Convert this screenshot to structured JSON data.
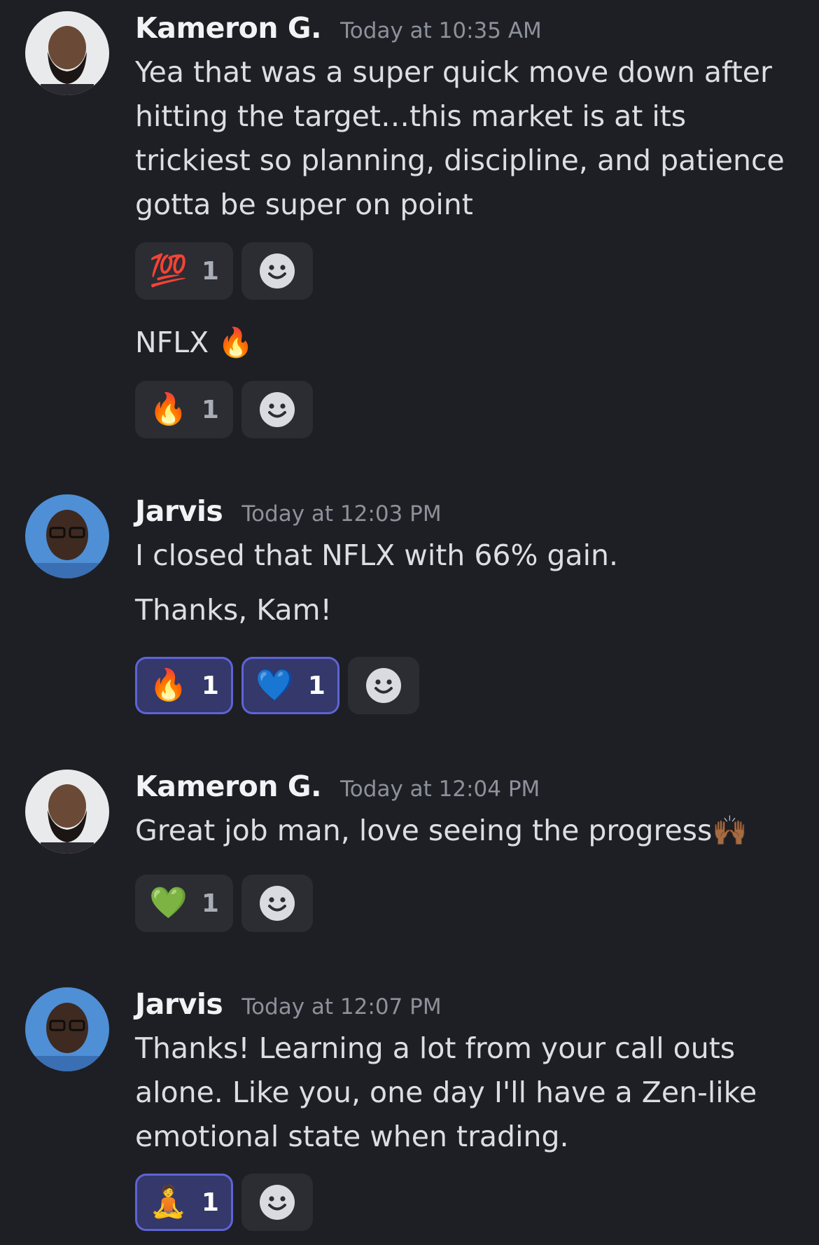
{
  "messages": [
    {
      "author": "Kameron G.",
      "timestamp": "Today at 10:35 AM",
      "avatar": "avatar-kameron",
      "lines": [
        {
          "text": "Yea that was a super quick move down after hitting the target…this market is at its trickiest so planning, discipline, and patience gotta be super on point",
          "reactions": [
            {
              "emoji": "💯",
              "count": "1",
              "active": false
            }
          ]
        },
        {
          "text": "NFLX 🔥",
          "reactions": [
            {
              "emoji": "🔥",
              "count": "1",
              "active": false
            }
          ]
        }
      ]
    },
    {
      "author": "Jarvis",
      "timestamp": "Today at 12:03 PM",
      "avatar": "avatar-jarvis",
      "lines": [
        {
          "text": "I closed that NFLX with 66% gain."
        },
        {
          "text": "Thanks, Kam!",
          "reactions": [
            {
              "emoji": "🔥",
              "count": "1",
              "active": true
            },
            {
              "emoji": "💙",
              "count": "1",
              "active": true
            }
          ]
        }
      ]
    },
    {
      "author": "Kameron G.",
      "timestamp": "Today at 12:04 PM",
      "avatar": "avatar-kameron",
      "lines": [
        {
          "text": "Great job man, love seeing the progress🙌🏾",
          "reactions": [
            {
              "emoji": "💚",
              "count": "1",
              "active": false
            }
          ]
        }
      ]
    },
    {
      "author": "Jarvis",
      "timestamp": "Today at 12:07 PM",
      "avatar": "avatar-jarvis",
      "lines": [
        {
          "text": "Thanks! Learning a lot from your call outs alone. Like you, one day I'll have a Zen-like emotional state when trading.",
          "reactions": [
            {
              "emoji": "🧘",
              "count": "1",
              "active": true
            }
          ]
        }
      ]
    }
  ],
  "icons": {
    "add_reaction": "smiley-add-reaction-icon"
  },
  "colors": {
    "background": "#1e1f24",
    "reaction_bg": "#2b2d33",
    "reaction_active_bg": "#34386a",
    "reaction_active_border": "#5d64d6"
  }
}
